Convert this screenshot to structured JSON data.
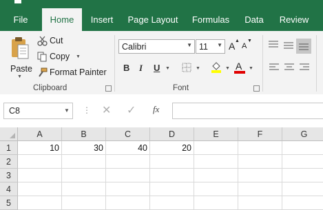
{
  "ribbon_tabs": [
    "File",
    "Home",
    "Insert",
    "Page Layout",
    "Formulas",
    "Data",
    "Review"
  ],
  "active_tab": "Home",
  "clipboard": {
    "paste_label": "Paste",
    "cut_label": "Cut",
    "copy_label": "Copy",
    "format_painter_label": "Format Painter",
    "group_label": "Clipboard"
  },
  "font": {
    "family": "Calibri",
    "size": "11",
    "bold": "B",
    "italic": "I",
    "underline": "U",
    "grow": "A",
    "shrink": "A",
    "font_color_letter": "A",
    "group_label": "Font"
  },
  "colors": {
    "brand": "#217346",
    "highlight": "#ffff00",
    "font_color": "#e00000"
  },
  "formula_bar": {
    "name_box": "C8",
    "fx": "fx",
    "formula": ""
  },
  "sheet": {
    "columns": [
      "A",
      "B",
      "C",
      "D",
      "E",
      "F",
      "G"
    ],
    "rows": [
      "1",
      "2",
      "3",
      "4",
      "5"
    ],
    "cells": [
      [
        "10",
        "30",
        "40",
        "20",
        "",
        "",
        ""
      ],
      [
        "",
        "",
        "",
        "",
        "",
        "",
        ""
      ],
      [
        "",
        "",
        "",
        "",
        "",
        "",
        ""
      ],
      [
        "",
        "",
        "",
        "",
        "",
        "",
        ""
      ],
      [
        "",
        "",
        "",
        "",
        "",
        "",
        ""
      ]
    ]
  }
}
